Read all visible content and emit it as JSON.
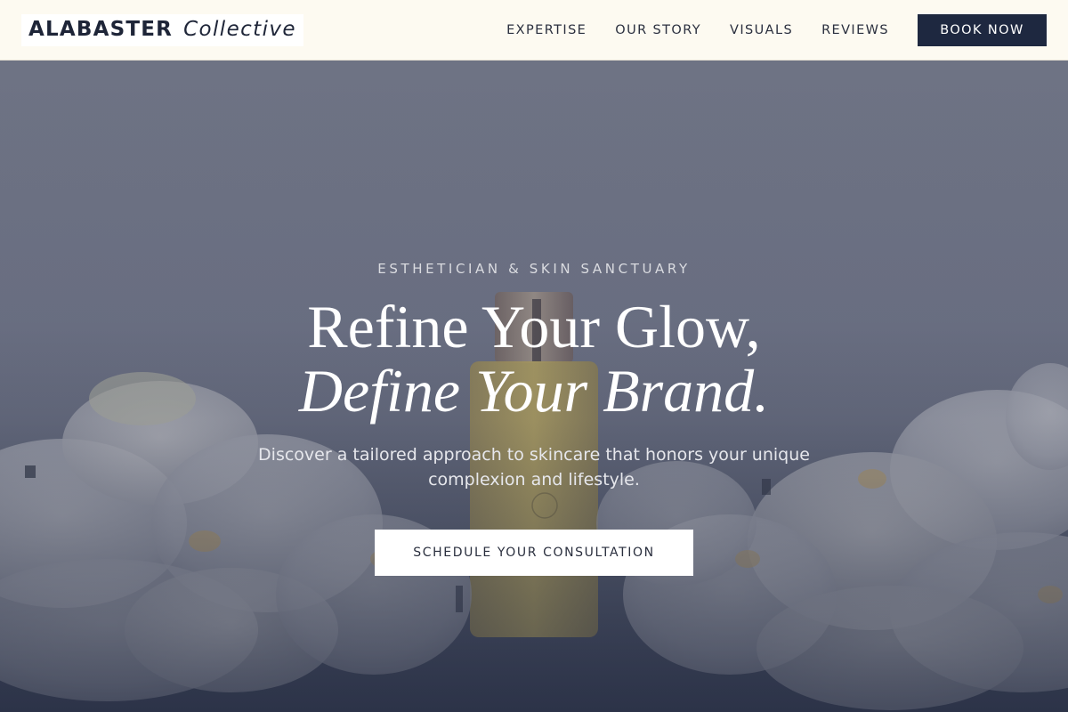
{
  "brand": {
    "name_main": "ALABASTER",
    "name_sub": "Collective"
  },
  "nav": {
    "items": [
      {
        "label": "EXPERTISE"
      },
      {
        "label": "OUR STORY"
      },
      {
        "label": "VISUALS"
      },
      {
        "label": "REVIEWS"
      }
    ],
    "cta_label": "BOOK NOW"
  },
  "hero": {
    "eyebrow": "ESTHETICIAN & SKIN SANCTUARY",
    "headline_line1": "Refine Your Glow,",
    "headline_line2": "Define Your Brand.",
    "subtext": "Discover a tailored approach to skincare that honors your unique complexion and lifestyle.",
    "cta_label": "SCHEDULE YOUR CONSULTATION",
    "background_image": "skincare-bottle-orchids-photo"
  },
  "colors": {
    "header_bg": "#fdfaf1",
    "primary_navy": "#1e2840",
    "hero_overlay": "#6b7083",
    "text_light": "#ffffff"
  }
}
